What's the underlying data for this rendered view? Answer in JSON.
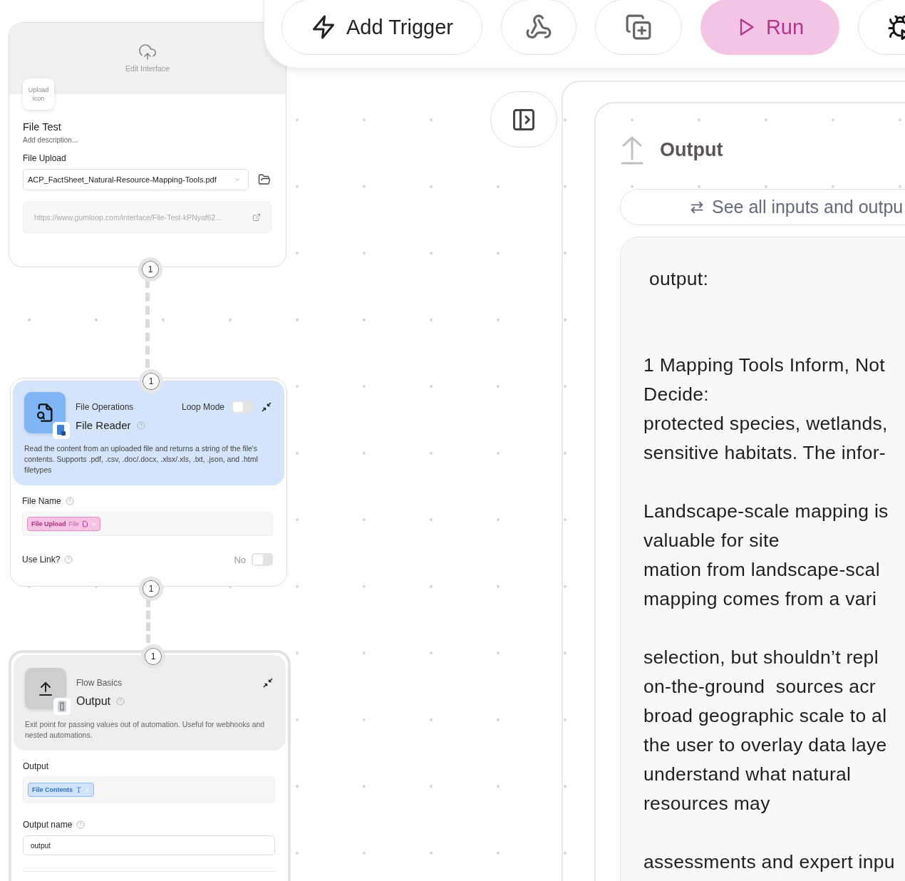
{
  "toolbar": {
    "buttons": [
      {
        "kind": "trigger",
        "label": "Add Trigger"
      },
      {
        "kind": "webhook"
      },
      {
        "kind": "duplicate"
      },
      {
        "kind": "run",
        "label": "Run"
      },
      {
        "kind": "debug"
      }
    ]
  },
  "interface_node": {
    "header_label": "Edit Interface",
    "icon_label": "Upload icon",
    "title": "File Test",
    "description": "Add description...",
    "field_label": "File Upload",
    "file_value": "ACP_FactSheet_Natural-Resource-Mapping-Tools.pdf",
    "url": "https://www.gumloop.com/interface/File-Test-kPNyaf62..."
  },
  "connectors": [
    {
      "label": "1"
    },
    {
      "label": "1"
    },
    {
      "label": "1"
    },
    {
      "label": "1"
    }
  ],
  "file_reader_node": {
    "category": "File Operations",
    "title": "File Reader",
    "loop_mode": {
      "label": "Loop Mode",
      "on": false
    },
    "description": "Read the content from an uploaded file and returns a string of the file's contents. Supports .pdf, .csv, .doc/.docx, .xlsx/.xls, .txt, .json, and .html filetypes",
    "file_name": {
      "label": "File Name",
      "chip": "File Upload",
      "chip_type": "File"
    },
    "use_link": {
      "label": "Use Link?",
      "value": "No",
      "on": false
    }
  },
  "output_node": {
    "category": "Flow Basics",
    "title": "Output",
    "description": "Exit point for passing values out of automation. Useful for webhooks and nested automations.",
    "output": {
      "label": "Output",
      "chip": "File Contents"
    },
    "output_name": {
      "label": "Output name",
      "value": "output"
    }
  },
  "output_panel": {
    "title": "Output",
    "see_all": "See all inputs and outpu",
    "result_label": "output:",
    "paragraphs": [
      [
        "1 Mapping Tools Inform, Not",
        "Decide:",
        "protected species, wetlands,",
        "sensitive habitats. The infor-"
      ],
      [
        "Landscape-scale mapping is",
        "valuable for site",
        "mation from landscape-scal",
        "mapping comes from a vari"
      ],
      [
        "selection, but shouldn’t repl",
        "on-the-ground  sources acr",
        "broad geographic scale to al",
        "the user to overlay data laye",
        "understand what natural",
        "resources may"
      ],
      [
        "assessments and expert inpu"
      ]
    ]
  }
}
